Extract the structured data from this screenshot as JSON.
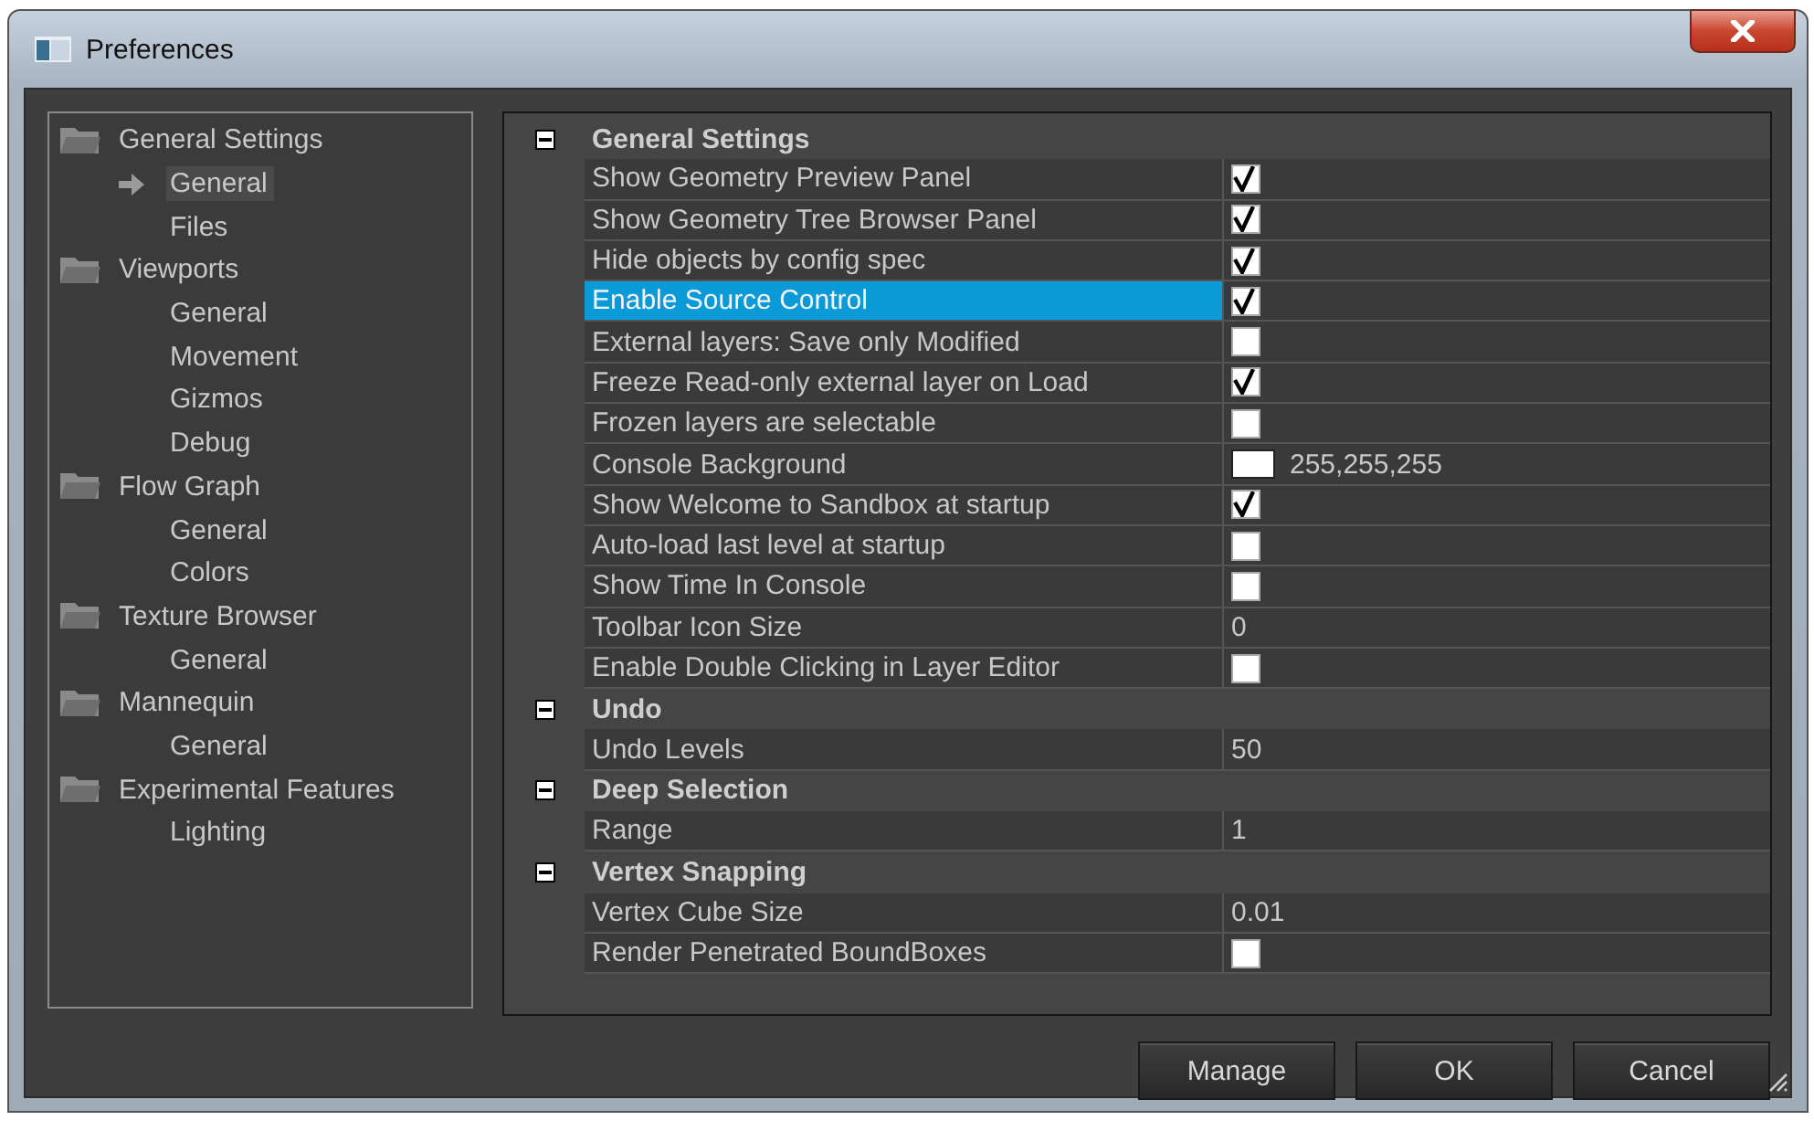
{
  "window": {
    "title": "Preferences"
  },
  "sidebar": {
    "items": [
      {
        "label": "General Settings",
        "selected": false,
        "expanded": true,
        "children": [
          {
            "label": "General",
            "selected": true
          },
          {
            "label": "Files",
            "selected": false
          }
        ]
      },
      {
        "label": "Viewports",
        "selected": false,
        "expanded": true,
        "children": [
          {
            "label": "General",
            "selected": false
          },
          {
            "label": "Movement",
            "selected": false
          },
          {
            "label": "Gizmos",
            "selected": false
          },
          {
            "label": "Debug",
            "selected": false
          }
        ]
      },
      {
        "label": "Flow Graph",
        "selected": false,
        "expanded": true,
        "children": [
          {
            "label": "General",
            "selected": false
          },
          {
            "label": "Colors",
            "selected": false
          }
        ]
      },
      {
        "label": "Texture Browser",
        "selected": false,
        "expanded": true,
        "children": [
          {
            "label": "General",
            "selected": false
          }
        ]
      },
      {
        "label": "Mannequin",
        "selected": false,
        "expanded": true,
        "children": [
          {
            "label": "General",
            "selected": false
          }
        ]
      },
      {
        "label": "Experimental Features",
        "selected": false,
        "expanded": true,
        "children": [
          {
            "label": "Lighting",
            "selected": false
          }
        ]
      }
    ]
  },
  "sections": [
    {
      "title": "General Settings",
      "expanded": true,
      "rows": [
        {
          "label": "Show Geometry Preview Panel",
          "kind": "checkbox",
          "checked": true,
          "selected": false
        },
        {
          "label": "Show Geometry Tree Browser Panel",
          "kind": "checkbox",
          "checked": true,
          "selected": false
        },
        {
          "label": "Hide objects by config spec",
          "kind": "checkbox",
          "checked": true,
          "selected": false
        },
        {
          "label": "Enable Source Control",
          "kind": "checkbox",
          "checked": true,
          "selected": true
        },
        {
          "label": "External layers: Save only Modified",
          "kind": "checkbox",
          "checked": false,
          "selected": false
        },
        {
          "label": "Freeze Read-only external layer on Load",
          "kind": "checkbox",
          "checked": true,
          "selected": false
        },
        {
          "label": "Frozen layers are selectable",
          "kind": "checkbox",
          "checked": false,
          "selected": false
        },
        {
          "label": "Console Background",
          "kind": "color",
          "color": "#ffffff",
          "value": "255,255,255",
          "selected": false
        },
        {
          "label": "Show Welcome to Sandbox at startup",
          "kind": "checkbox",
          "checked": true,
          "selected": false
        },
        {
          "label": "Auto-load last level at startup",
          "kind": "checkbox",
          "checked": false,
          "selected": false
        },
        {
          "label": "Show Time In Console",
          "kind": "checkbox",
          "checked": false,
          "selected": false
        },
        {
          "label": "Toolbar Icon Size",
          "kind": "text",
          "value": "0",
          "selected": false
        },
        {
          "label": "Enable Double Clicking in Layer Editor",
          "kind": "checkbox",
          "checked": false,
          "selected": false
        }
      ]
    },
    {
      "title": "Undo",
      "expanded": true,
      "rows": [
        {
          "label": "Undo Levels",
          "kind": "text",
          "value": "50",
          "selected": false
        }
      ]
    },
    {
      "title": "Deep Selection",
      "expanded": true,
      "rows": [
        {
          "label": "Range",
          "kind": "text",
          "value": "1",
          "selected": false
        }
      ]
    },
    {
      "title": "Vertex Snapping",
      "expanded": true,
      "rows": [
        {
          "label": "Vertex Cube Size",
          "kind": "text",
          "value": "0.01",
          "selected": false
        },
        {
          "label": "Render Penetrated BoundBoxes",
          "kind": "checkbox",
          "checked": false,
          "selected": false
        }
      ]
    }
  ],
  "buttons": [
    "Manage",
    "OK",
    "Cancel"
  ]
}
